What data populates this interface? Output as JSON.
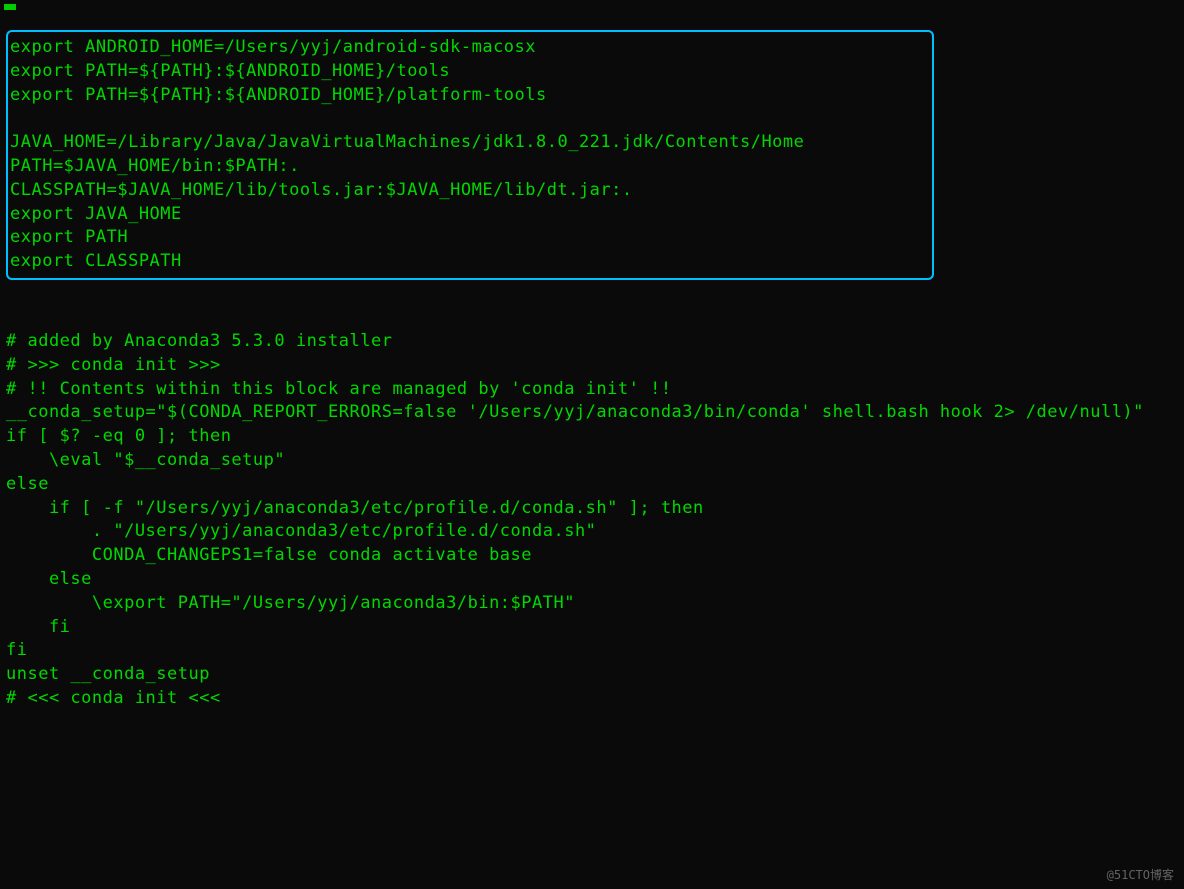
{
  "terminal": {
    "highlighted_block": {
      "lines": [
        "export ANDROID_HOME=/Users/yyj/android-sdk-macosx",
        "export PATH=${PATH}:${ANDROID_HOME}/tools",
        "export PATH=${PATH}:${ANDROID_HOME}/platform-tools",
        "",
        "JAVA_HOME=/Library/Java/JavaVirtualMachines/jdk1.8.0_221.jdk/Contents/Home",
        "PATH=$JAVA_HOME/bin:$PATH:.",
        "CLASSPATH=$JAVA_HOME/lib/tools.jar:$JAVA_HOME/lib/dt.jar:.",
        "export JAVA_HOME",
        "export PATH",
        "export CLASSPATH"
      ]
    },
    "main_block": {
      "lines": [
        "# added by Anaconda3 5.3.0 installer",
        "# >>> conda init >>>",
        "# !! Contents within this block are managed by 'conda init' !!",
        "__conda_setup=\"$(CONDA_REPORT_ERRORS=false '/Users/yyj/anaconda3/bin/conda' shell.bash hook 2> /dev/null)\"",
        "if [ $? -eq 0 ]; then",
        "    \\eval \"$__conda_setup\"",
        "else",
        "    if [ -f \"/Users/yyj/anaconda3/etc/profile.d/conda.sh\" ]; then",
        "        . \"/Users/yyj/anaconda3/etc/profile.d/conda.sh\"",
        "        CONDA_CHANGEPS1=false conda activate base",
        "    else",
        "        \\export PATH=\"/Users/yyj/anaconda3/bin:$PATH\"",
        "    fi",
        "fi",
        "unset __conda_setup",
        "# <<< conda init <<<"
      ]
    }
  },
  "watermark": "@51CTO博客"
}
